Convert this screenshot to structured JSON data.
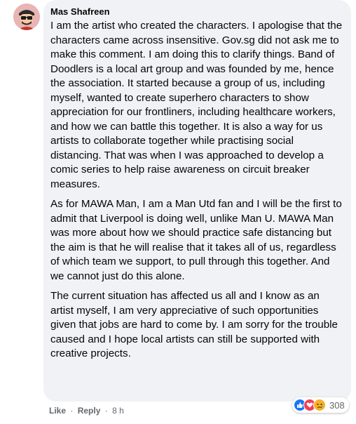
{
  "comment": {
    "author": "Mas Shafreen",
    "paragraphs": [
      "I am the artist who created the characters. I apologise that the characters came across insensitive. Gov.sg did not ask me to make this comment. I am doing this to clarify things. Band of Doodlers is a local art group and was founded by me, hence the association. It started because a group of us, including myself, wanted to create superhero characters to show appreciation for our frontliners, including healthcare workers, and how we can battle this together. It is also a way for us artists to collaborate together while practising social distancing. That was when I was approached to develop a comic series to help raise awareness on circuit breaker measures.",
      "As for MAWA Man, I am a Man Utd fan and I will be the first to admit that Liverpool is doing well, unlike Man U. MAWA Man was more about how we should practice safe distancing but the aim is that he will realise that it takes all of us, regardless of which team we support, to pull through this together. And we cannot just do this alone.",
      "The current situation has affected us all and I know as an artist myself, I am very appreciative of such opportunities given that jobs are hard to come by. I am sorry for the trouble caused and I hope local artists can still be supported with creative projects."
    ]
  },
  "actions": {
    "like": "Like",
    "separator": "·",
    "reply": "Reply",
    "time": "8 h"
  },
  "reactions": {
    "count": "308",
    "icons": [
      "like-reaction-icon",
      "love-reaction-icon",
      "sad-reaction-icon"
    ],
    "colors": {
      "like": "#1877f2",
      "love": "#f33e58",
      "sad": "#f7b125"
    }
  },
  "colors": {
    "bubble_background": "#f0f2f5",
    "text": "#050505",
    "secondary_text": "#65676b"
  }
}
